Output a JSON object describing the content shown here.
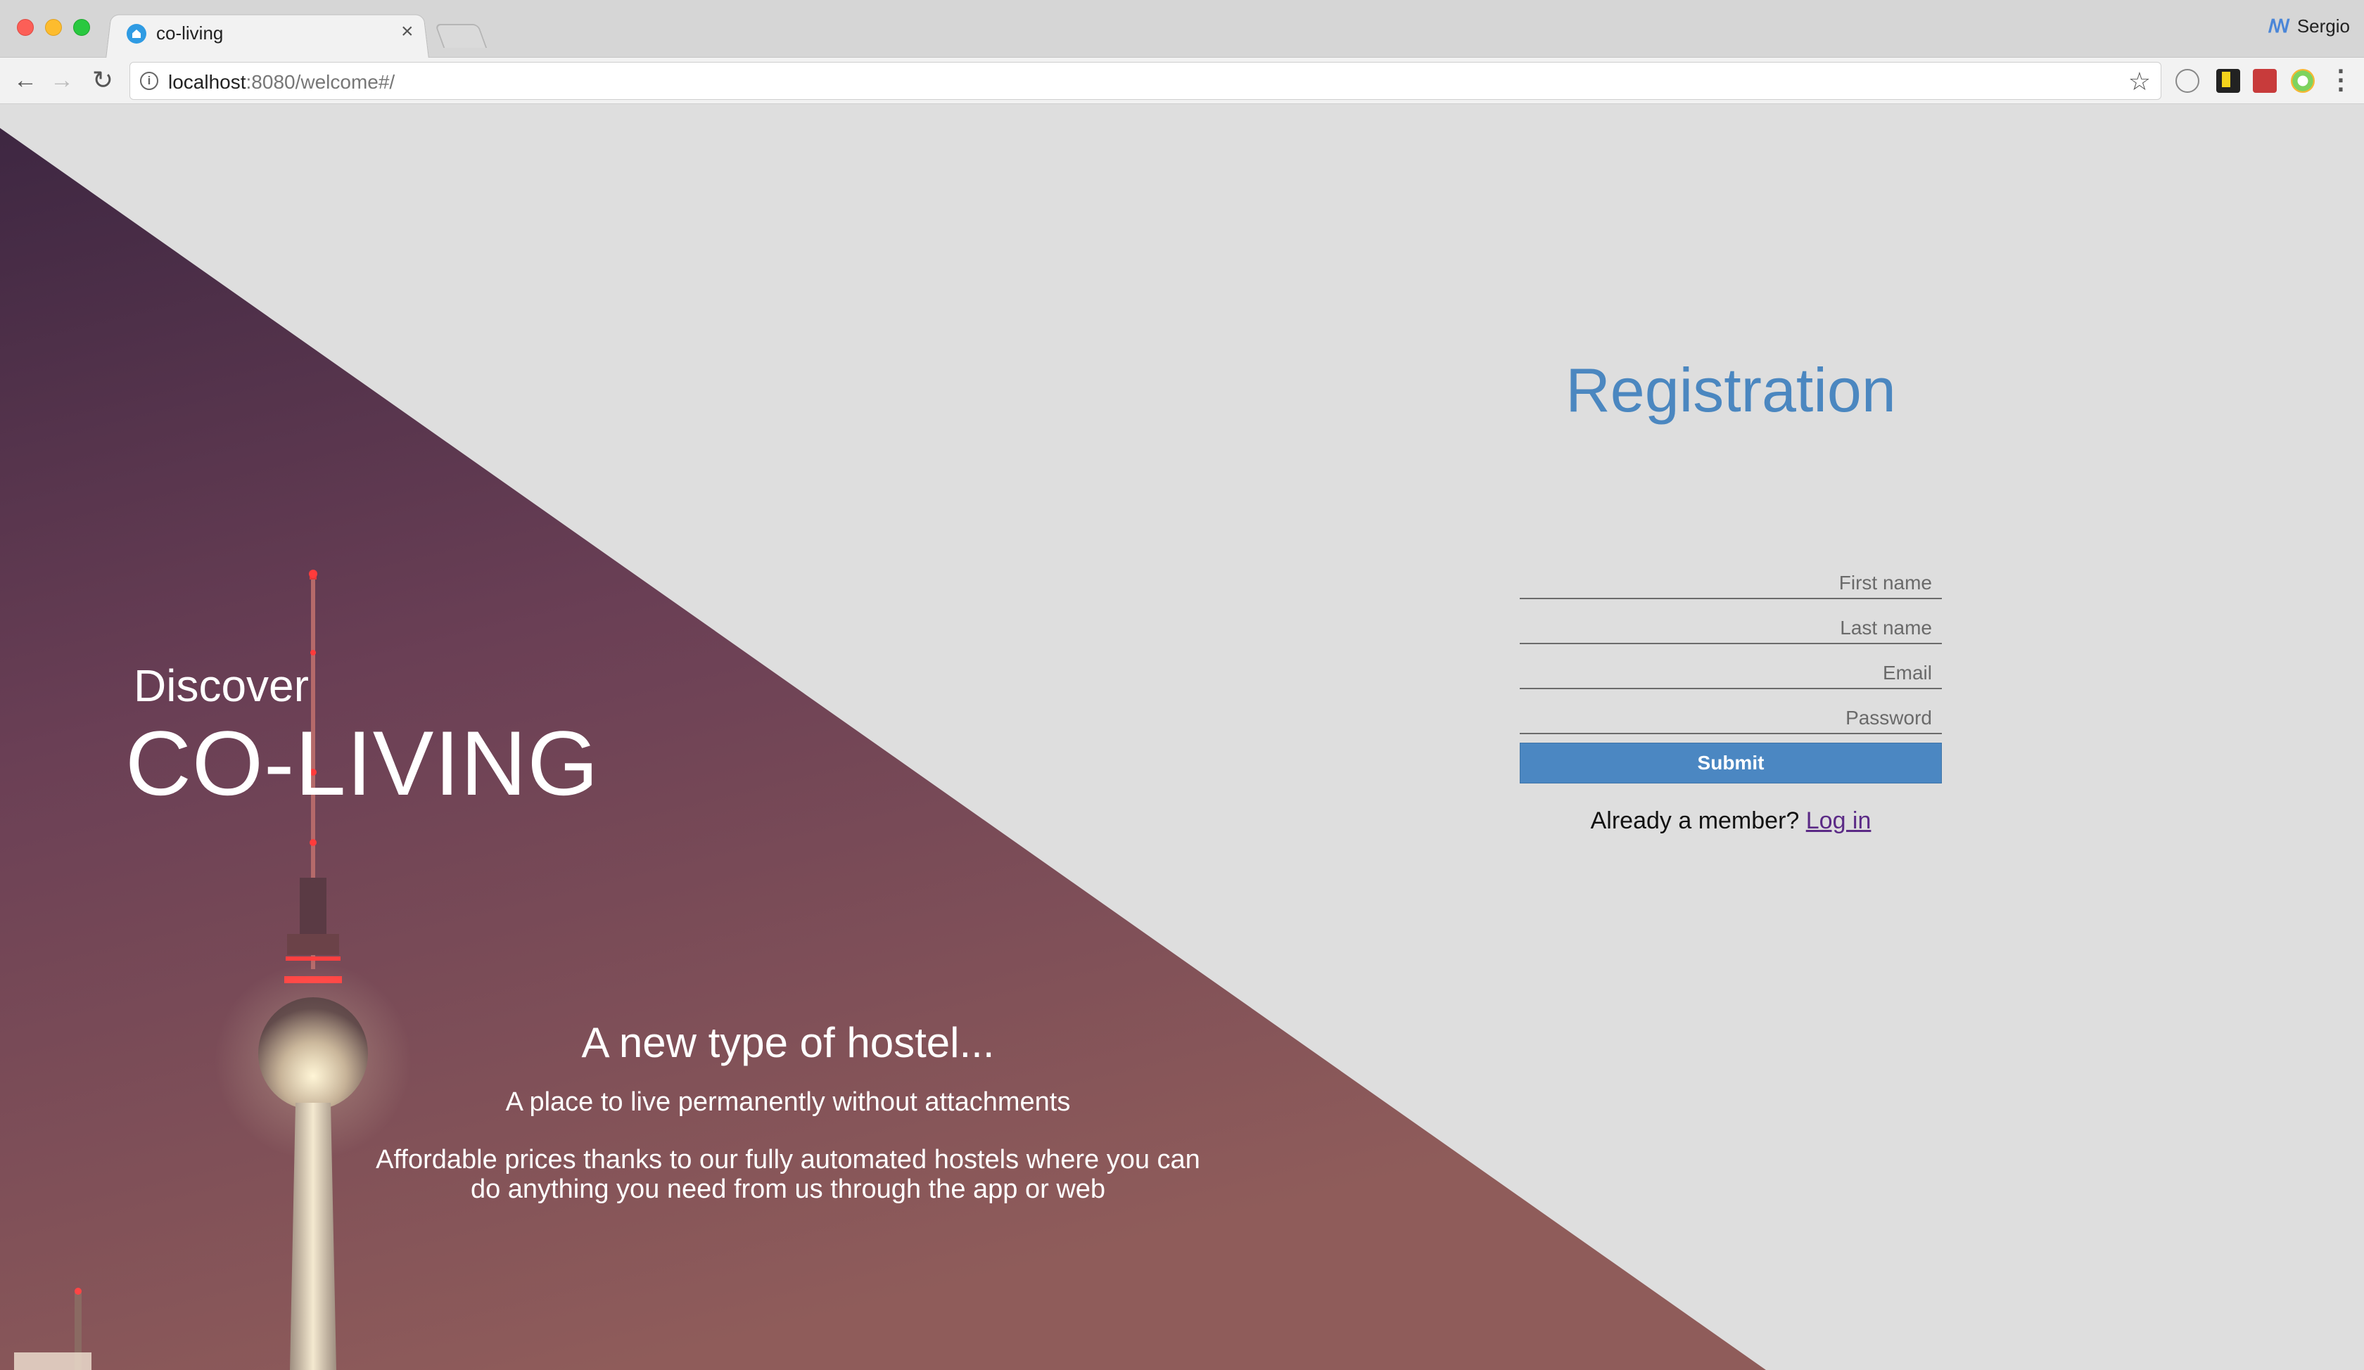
{
  "browser": {
    "tab_title": "co-living",
    "profile_name": "Sergio",
    "url_host": "localhost",
    "url_rest": ":8080/welcome#/",
    "icons": {
      "back": "back-arrow-icon",
      "forward": "forward-arrow-icon",
      "reload": "reload-icon",
      "info": "info-icon",
      "bookmark": "star-icon",
      "menu": "more-vert-icon"
    }
  },
  "hero": {
    "discover": "Discover",
    "title": "CO-LIVING",
    "tagline": "A new type of hostel...",
    "subtitle": "A place to live permanently without attachments",
    "description": "Affordable prices thanks to our fully automated hostels where you can do anything you need from us through the app or web"
  },
  "registration": {
    "title": "Registration",
    "first_name_placeholder": "First name",
    "last_name_placeholder": "Last name",
    "email_placeholder": "Email",
    "password_placeholder": "Password",
    "submit_label": "Submit",
    "member_prompt": "Already a member?",
    "login_link": "Log in"
  },
  "colors": {
    "accent": "#4b87c2",
    "title": "#4b87c0",
    "background": "#dedede",
    "hero_top": "#3e2742",
    "hero_bottom": "#8c5b5a"
  }
}
